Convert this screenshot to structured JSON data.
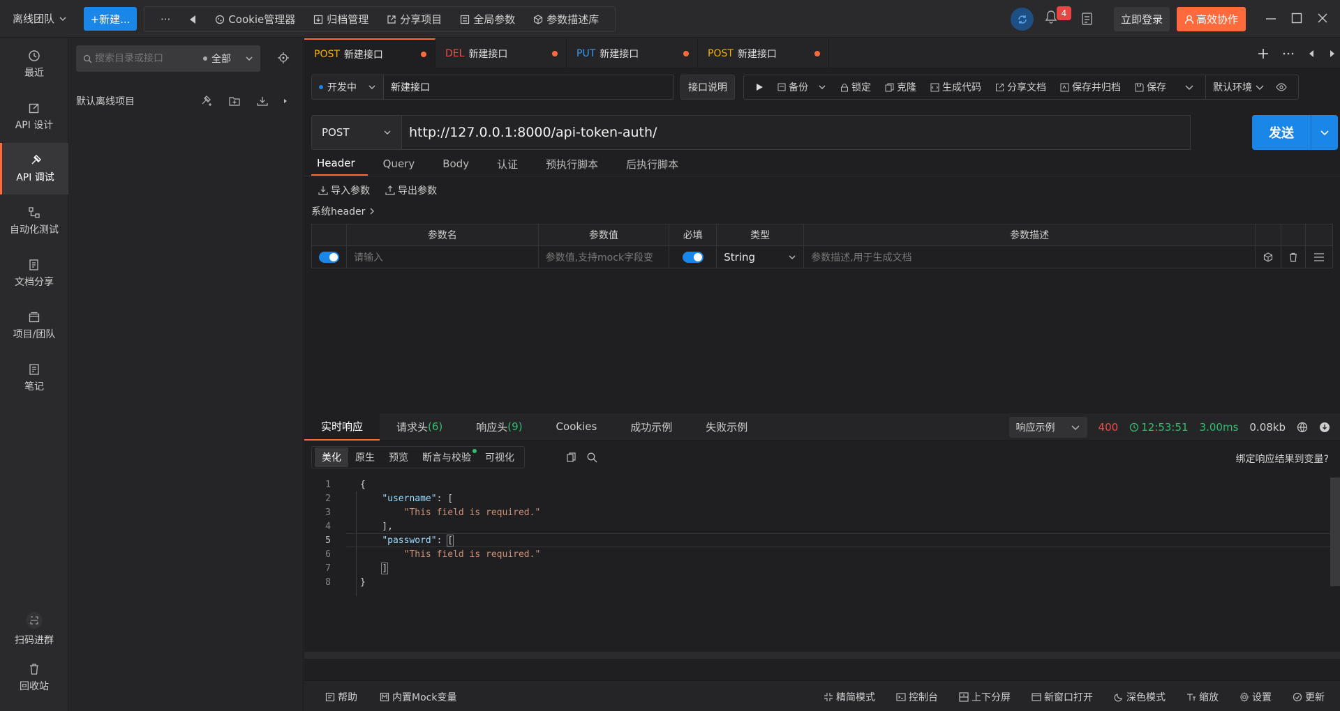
{
  "app": {
    "team": "离线团队",
    "new_btn": "+新建...",
    "more": "···",
    "top_nav": [
      "Cookie管理器",
      "归档管理",
      "分享项目",
      "全局参数",
      "参数描述库"
    ],
    "notif_count": "4",
    "login": "立即登录",
    "collab": "高效协作"
  },
  "rail": {
    "items": [
      "最近",
      "API 设计",
      "API 调试",
      "自动化测试",
      "文档分享",
      "项目/团队",
      "笔记"
    ],
    "qr": "扫码进群",
    "trash": "回收站"
  },
  "sidebar": {
    "search_placeholder": "搜索目录或接口",
    "scope": "全部",
    "project": "默认离线项目"
  },
  "tabs": [
    {
      "method": "POST",
      "name": "新建接口"
    },
    {
      "method": "DEL",
      "name": "新建接口"
    },
    {
      "method": "PUT",
      "name": "新建接口"
    },
    {
      "method": "POST",
      "name": "新建接口"
    }
  ],
  "request": {
    "status": "开发中",
    "name": "新建接口",
    "desc_btn": "接口说明",
    "toolbar": [
      "备份",
      "锁定",
      "克隆",
      "生成代码",
      "分享文档",
      "保存并归档",
      "保存"
    ],
    "env": "默认环境",
    "method": "POST",
    "url": "http://127.0.0.1:8000/api-token-auth/",
    "send": "发送"
  },
  "param_tabs": [
    "Header",
    "Query",
    "Body",
    "认证",
    "预执行脚本",
    "后执行脚本"
  ],
  "params": {
    "import": "导入参数",
    "export": "导出参数",
    "system_header": "系统header",
    "columns": [
      "参数名",
      "参数值",
      "必填",
      "类型",
      "参数描述"
    ],
    "row": {
      "name_placeholder": "请输入",
      "value_placeholder": "参数值,支持mock字段变",
      "type": "String",
      "desc_placeholder": "参数描述,用于生成文档"
    }
  },
  "response": {
    "tabs": [
      {
        "label": "实时响应",
        "count": ""
      },
      {
        "label": "请求头",
        "count": "(6)"
      },
      {
        "label": "响应头",
        "count": "(9)"
      },
      {
        "label": "Cookies",
        "count": ""
      },
      {
        "label": "成功示例",
        "count": ""
      },
      {
        "label": "失败示例",
        "count": ""
      }
    ],
    "example": "响应示例",
    "status": "400",
    "time": "12:53:51",
    "duration": "3.00ms",
    "size": "0.08kb",
    "view_tabs": [
      "美化",
      "原生",
      "预览",
      "断言与校验",
      "可视化"
    ],
    "bind_var": "绑定响应结果到变量?",
    "body": {
      "key1": "\"username\"",
      "key2": "\"password\"",
      "msg": "\"This field is required.\""
    }
  },
  "footer": {
    "left": [
      "帮助",
      "内置Mock变量"
    ],
    "right": [
      "精简模式",
      "控制台",
      "上下分屏",
      "新窗口打开",
      "深色模式",
      "缩放",
      "设置",
      "更新"
    ]
  },
  "colors": {
    "accent": "#ff6a3d",
    "primary": "#1a86e8",
    "success": "#2fbf71",
    "error": "#e84545"
  }
}
